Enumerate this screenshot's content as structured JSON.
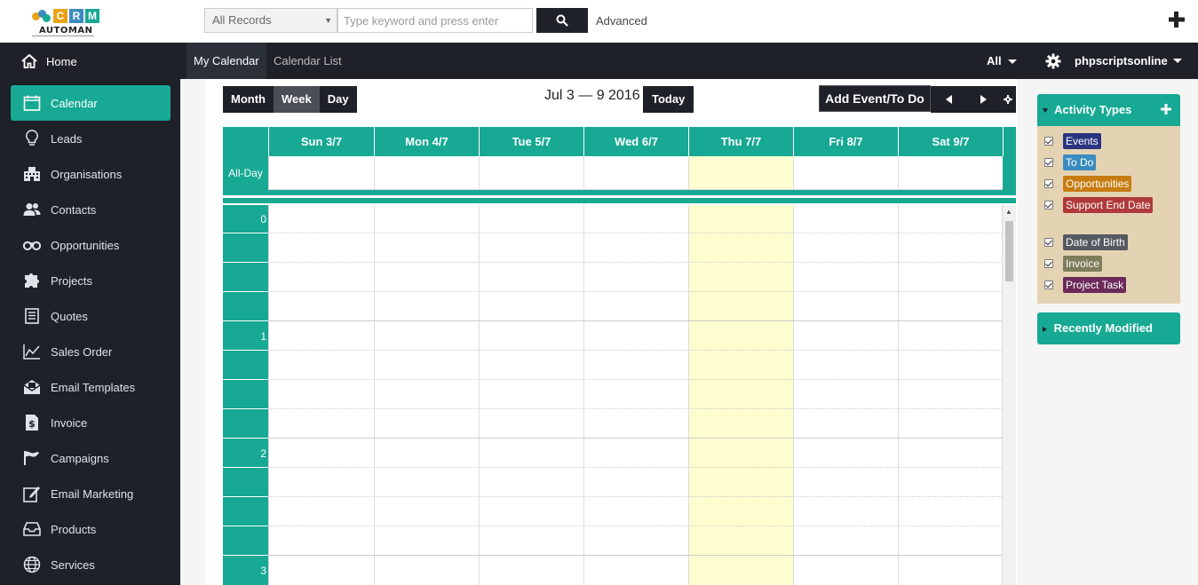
{
  "logo": {
    "letters": [
      "C",
      "R",
      "M"
    ],
    "sub": "AUTOMAN"
  },
  "search": {
    "scope": "All Records",
    "placeholder": "Type keyword and press enter",
    "advanced": "Advanced"
  },
  "sidebar": {
    "home": "Home",
    "items": [
      {
        "label": "Calendar",
        "icon": "calendar-icon",
        "active": true
      },
      {
        "label": "Leads",
        "icon": "lightbulb-icon"
      },
      {
        "label": "Organisations",
        "icon": "building-icon"
      },
      {
        "label": "Contacts",
        "icon": "users-icon"
      },
      {
        "label": "Opportunities",
        "icon": "binoculars-icon"
      },
      {
        "label": "Projects",
        "icon": "puzzle-icon"
      },
      {
        "label": "Quotes",
        "icon": "document-icon"
      },
      {
        "label": "Sales Order",
        "icon": "chart-line-icon"
      },
      {
        "label": "Email Templates",
        "icon": "envelope-open-icon"
      },
      {
        "label": "Invoice",
        "icon": "invoice-dollar-icon"
      },
      {
        "label": "Campaigns",
        "icon": "flag-icon"
      },
      {
        "label": "Email Marketing",
        "icon": "edit-icon"
      },
      {
        "label": "Products",
        "icon": "inbox-icon"
      },
      {
        "label": "Services",
        "icon": "globe-icon"
      }
    ]
  },
  "nav": {
    "tabs": [
      "My Calendar",
      "Calendar List"
    ],
    "filter": "All",
    "user": "phpscriptsonline"
  },
  "toolbar": {
    "views": [
      "Month",
      "Week",
      "Day"
    ],
    "active_view": "Week",
    "range": "Jul 3 — 9 2016",
    "today": "Today",
    "add": "Add Event/To Do"
  },
  "calendar": {
    "days": [
      "Sun 3/7",
      "Mon 4/7",
      "Tue 5/7",
      "Wed 6/7",
      "Thu 7/7",
      "Fri 8/7",
      "Sat 9/7"
    ],
    "today_index": 4,
    "allday_label": "All-Day",
    "hours": [
      "0",
      "1",
      "2",
      "3"
    ]
  },
  "activity": {
    "title": "Activity Types",
    "types": [
      {
        "label": "Events",
        "color": "#2a3580"
      },
      {
        "label": "To Do",
        "color": "#3a8cc0"
      },
      {
        "label": "Opportunities",
        "color": "#c77c12"
      },
      {
        "label": "Support End Date",
        "color": "#b03a3a"
      },
      {
        "label": "Date of Birth",
        "color": "#555a61"
      },
      {
        "label": "Invoice",
        "color": "#7e7d5a"
      },
      {
        "label": "Project Task",
        "color": "#6b2a5a"
      }
    ]
  },
  "recent": {
    "title": "Recently Modified"
  },
  "colors": {
    "accent": "#17a994",
    "dark": "#1e2128",
    "today": "#fdfdcf"
  }
}
